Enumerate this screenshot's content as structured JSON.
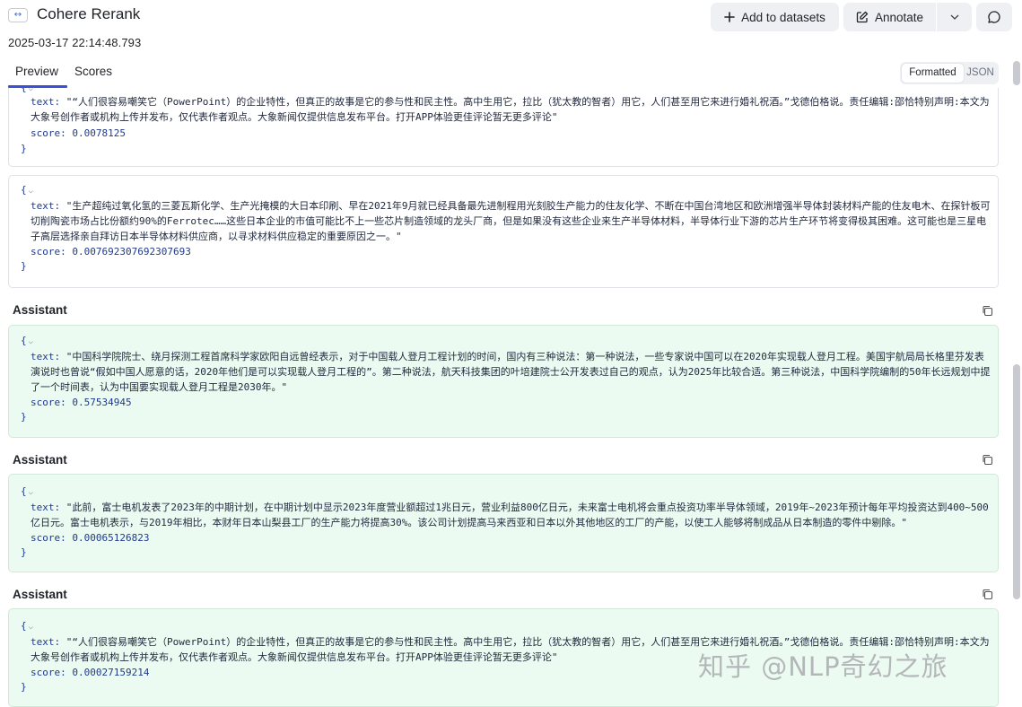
{
  "header": {
    "title": "Cohere Rerank",
    "timestamp": "2025-03-17 22:14:48.793",
    "add_to_datasets": "Add to datasets",
    "annotate": "Annotate"
  },
  "tabs": [
    {
      "label": "Preview",
      "active": true
    },
    {
      "label": "Scores",
      "active": false
    }
  ],
  "view_toggle": {
    "formatted": "Formatted",
    "json": "JSON",
    "selected": "Formatted"
  },
  "blocks": [
    {
      "role": "",
      "text_key": "text:",
      "text": "\"“人们很容易嘲笑它（PowerPoint）的企业特性，但真正的故事是它的参与性和民主性。高中生用它，拉比（犹太教的智者）用它，人们甚至用它来进行婚礼祝酒。”戈德伯格说。责任编辑:邵恰特别声明:本文为大象号创作者或机构上传并发布，仅代表作者观点。大象新闻仅提供信息发布平台。打开APP体验更佳评论暂无更多评论\"",
      "score_key": "score:",
      "score": "0.0078125"
    },
    {
      "role": "",
      "text_key": "text:",
      "text": "\"生产超纯过氧化氢的三菱瓦斯化学、生产光掩模的大日本印刷、早在2021年9月就已经具备最先进制程用光刻胶生产能力的住友化学、不断在中国台湾地区和欧洲增强半导体封装材料产能的住友电木、在探针板可切削陶瓷市场占比份额约90%的Ferrotec……这些日本企业的市值可能比不上一些芯片制造领域的龙头厂商，但是如果没有这些企业来生产半导体材料，半导体行业下游的芯片生产环节将变得极其困难。这可能也是三星电子高层选择亲自拜访日本半导体材料供应商，以寻求材料供应稳定的重要原因之一。\"",
      "score_key": "score:",
      "score": "0.007692307692307693"
    },
    {
      "role": "Assistant",
      "text_key": "text:",
      "text": "\"中国科学院院士、绕月探测工程首席科学家欧阳自远曾经表示，对于中国载人登月工程计划的时间，国内有三种说法：第一种说法，一些专家说中国可以在2020年实现载人登月工程。美国宇航局局长格里芬发表演说时也曾说“假如中国人愿意的话，2020年他们是可以实现载人登月工程的”。第二种说法，航天科技集团的叶培建院士公开发表过自己的观点，认为2025年比较合适。第三种说法，中国科学院编制的50年长远规划中提了一个时间表，认为中国要实现载人登月工程是2030年。\"",
      "score_key": "score:",
      "score": "0.57534945"
    },
    {
      "role": "Assistant",
      "text_key": "text:",
      "text": "\"此前，富士电机发表了2023年的中期计划，在中期计划中显示2023年度营业额超过1兆日元，营业利益800亿日元，未来富士电机将会重点投资功率半导体领域，2019年~2023年预计每年平均投资达到400~500亿日元。富士电机表示，与2019年相比，本财年日本山梨县工厂的生产能力将提高30%。该公司计划提高马来西亚和日本以外其他地区的工厂的产能，以使工人能够将制成品从日本制造的零件中剔除。\"",
      "score_key": "score:",
      "score": "0.00065126823"
    },
    {
      "role": "Assistant",
      "text_key": "text:",
      "text": "\"“人们很容易嘲笑它（PowerPoint）的企业特性，但真正的故事是它的参与性和民主性。高中生用它，拉比（犹太教的智者）用它，人们甚至用它来进行婚礼祝酒。”戈德伯格说。责任编辑:邵恰特别声明:本文为大象号创作者或机构上传并发布，仅代表作者观点。大象新闻仅提供信息发布平台。打开APP体验更佳评论暂无更多评论\"",
      "score_key": "score:",
      "score": "0.00027159214"
    }
  ],
  "brace_open": "{",
  "brace_close": "}",
  "watermark": "知乎 @NLP奇幻之旅",
  "colors": {
    "accent": "#3b4fd8",
    "assistant_bg": "#ecfbf1",
    "code_blue": "#1f3a8a"
  }
}
